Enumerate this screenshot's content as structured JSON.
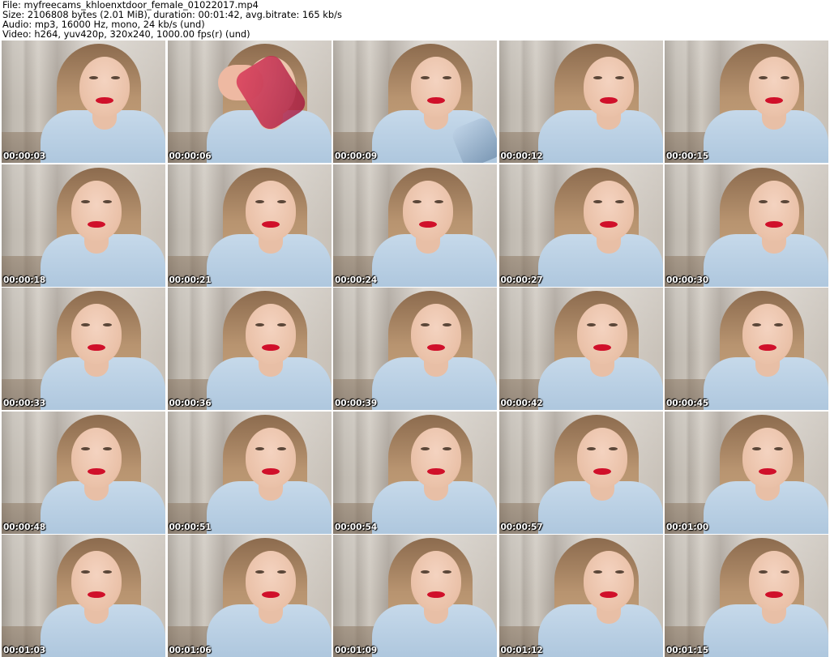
{
  "header": {
    "file_line": "File: myfreecams_khloenxtdoor_female_01022017.mp4",
    "size_line": "Size: 2106808 bytes (2.01 MiB), duration: 00:01:42, avg.bitrate: 165 kb/s",
    "audio_line": "Audio: mp3, 16000 Hz, mono, 24 kb/s (und)",
    "video_line": "Video: h264, yuv420p, 320x240, 1000.00 fps(r) (und)"
  },
  "thumbnails": [
    {
      "timestamp": "00:00:03"
    },
    {
      "timestamp": "00:00:06"
    },
    {
      "timestamp": "00:00:09"
    },
    {
      "timestamp": "00:00:12"
    },
    {
      "timestamp": "00:00:15"
    },
    {
      "timestamp": "00:00:18"
    },
    {
      "timestamp": "00:00:21"
    },
    {
      "timestamp": "00:00:24"
    },
    {
      "timestamp": "00:00:27"
    },
    {
      "timestamp": "00:00:30"
    },
    {
      "timestamp": "00:00:33"
    },
    {
      "timestamp": "00:00:36"
    },
    {
      "timestamp": "00:00:39"
    },
    {
      "timestamp": "00:00:42"
    },
    {
      "timestamp": "00:00:45"
    },
    {
      "timestamp": "00:00:48"
    },
    {
      "timestamp": "00:00:51"
    },
    {
      "timestamp": "00:00:54"
    },
    {
      "timestamp": "00:00:57"
    },
    {
      "timestamp": "00:01:00"
    },
    {
      "timestamp": "00:01:03"
    },
    {
      "timestamp": "00:01:06"
    },
    {
      "timestamp": "00:01:09"
    },
    {
      "timestamp": "00:01:12"
    },
    {
      "timestamp": "00:01:15"
    }
  ]
}
